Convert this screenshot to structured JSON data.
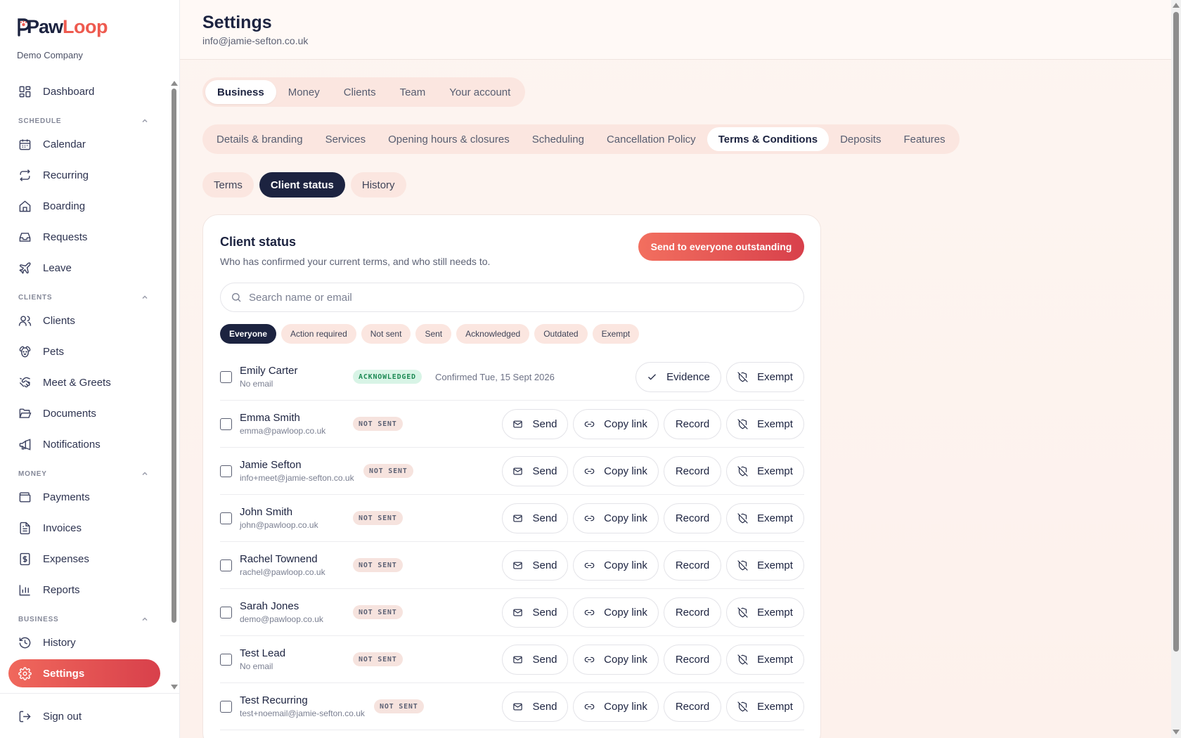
{
  "app": {
    "brand_part1": "Paw",
    "brand_part2": "Loop",
    "company": "Demo Company",
    "accent": "#ee5a4f"
  },
  "sidebar": {
    "dashboard": "Dashboard",
    "groups": {
      "schedule": "SCHEDULE",
      "clients": "CLIENTS",
      "money": "MONEY",
      "business": "BUSINESS"
    },
    "items": {
      "calendar": "Calendar",
      "recurring": "Recurring",
      "boarding": "Boarding",
      "requests": "Requests",
      "leave": "Leave",
      "clients": "Clients",
      "pets": "Pets",
      "meet_greets": "Meet & Greets",
      "documents": "Documents",
      "notifications": "Notifications",
      "payments": "Payments",
      "invoices": "Invoices",
      "expenses": "Expenses",
      "reports": "Reports",
      "history": "History",
      "settings": "Settings"
    },
    "sign_out": "Sign out"
  },
  "header": {
    "title": "Settings",
    "subtitle": "info@jamie-sefton.co.uk"
  },
  "tabs_primary": [
    "Business",
    "Money",
    "Clients",
    "Team",
    "Your account"
  ],
  "tabs_secondary": [
    "Details & branding",
    "Services",
    "Opening hours & closures",
    "Scheduling",
    "Cancellation Policy",
    "Terms & Conditions",
    "Deposits",
    "Features"
  ],
  "tabs_tertiary": [
    "Terms",
    "Client status",
    "History"
  ],
  "card": {
    "title": "Client status",
    "subtitle": "Who has confirmed your current terms, and who still needs to.",
    "send_all": "Send to everyone outstanding",
    "search_placeholder": "Search name or email",
    "filters": [
      "Everyone",
      "Action required",
      "Not sent",
      "Sent",
      "Acknowledged",
      "Outdated",
      "Exempt"
    ]
  },
  "buttons": {
    "send": "Send",
    "copy_link": "Copy link",
    "record": "Record",
    "exempt": "Exempt",
    "evidence": "Evidence"
  },
  "clients": [
    {
      "name": "Emily Carter",
      "email": "No email",
      "status": "ACKNOWLEDGED",
      "confirmed": "Confirmed Tue, 15 Sept 2026"
    },
    {
      "name": "Emma Smith",
      "email": "emma@pawloop.co.uk",
      "status": "NOT SENT"
    },
    {
      "name": "Jamie Sefton",
      "email": "info+meet@jamie-sefton.co.uk",
      "status": "NOT SENT"
    },
    {
      "name": "John Smith",
      "email": "john@pawloop.co.uk",
      "status": "NOT SENT"
    },
    {
      "name": "Rachel Townend",
      "email": "rachel@pawloop.co.uk",
      "status": "NOT SENT"
    },
    {
      "name": "Sarah Jones",
      "email": "demo@pawloop.co.uk",
      "status": "NOT SENT"
    },
    {
      "name": "Test Lead",
      "email": "No email",
      "status": "NOT SENT"
    },
    {
      "name": "Test Recurring",
      "email": "test+noemail@jamie-sefton.co.uk",
      "status": "NOT SENT"
    }
  ]
}
